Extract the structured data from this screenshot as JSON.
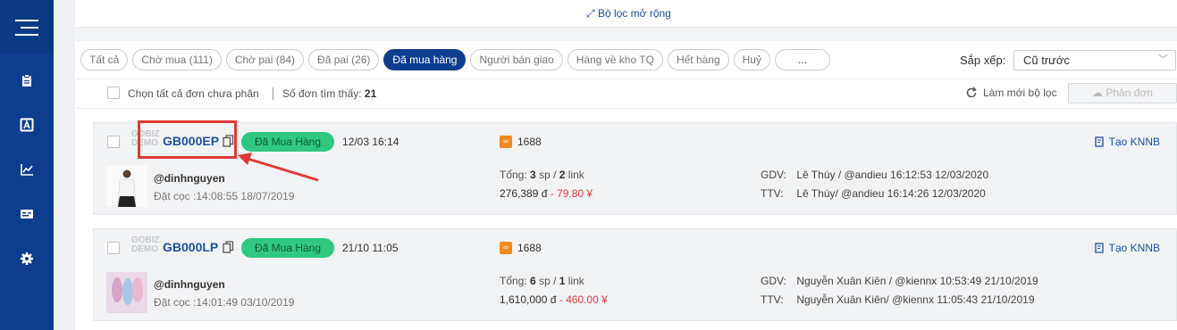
{
  "sidebar": {
    "items": [
      {
        "icon": "clipboard-icon"
      },
      {
        "icon": "font-icon"
      },
      {
        "icon": "chart-icon"
      },
      {
        "icon": "card-icon"
      },
      {
        "icon": "gear-icon"
      }
    ]
  },
  "header": {
    "filter_link": "Bộ lọc mở rộng"
  },
  "tabs": [
    {
      "label": "Tất cả",
      "active": false
    },
    {
      "label": "Chờ mua (111)",
      "active": false
    },
    {
      "label": "Chờ pai (84)",
      "active": false
    },
    {
      "label": "Đã pai (26)",
      "active": false
    },
    {
      "label": "Đã mua hàng",
      "active": true
    },
    {
      "label": "Người bán giao",
      "active": false
    },
    {
      "label": "Hàng về kho TQ",
      "active": false
    },
    {
      "label": "Hết hàng",
      "active": false
    },
    {
      "label": "Huỷ",
      "active": false
    },
    {
      "label": "...",
      "active": false
    }
  ],
  "sort": {
    "label": "Sắp xếp:",
    "value": "Cũ trước"
  },
  "toolbar": {
    "select_all": "Chọn tất cả đơn chưa phân",
    "found_label": "Số đơn tìm thấy:",
    "found_count": "21",
    "refresh": "Làm mới bộ lọc",
    "split": "Phân đơn"
  },
  "orders": [
    {
      "logo_text": "GOBIZ DEMO",
      "code": "GB000EP",
      "status": "Đã Mua Hàng",
      "datetime": "12/03 16:14",
      "source": "1688",
      "action": "Tạo KNNB",
      "buyer": "@dinhnguyen",
      "deposit": "Đặt cọc :14:08:55 18/07/2019",
      "tong_prefix": "Tổng:",
      "sp": "3",
      "sp_unit": "sp /",
      "link": "2",
      "link_unit": "link",
      "vnd": "276,389 đ",
      "cny": "- 79.80 ¥",
      "gdv_label": "GDV:",
      "gdv": "Lê Thúy / @andieu 16:12:53 12/03/2020",
      "ttv_label": "TTV:",
      "ttv": "Lê Thúy/ @andieu 16:14:26 12/03/2020"
    },
    {
      "logo_text": "GOBIZ DEMO",
      "code": "GB000LP",
      "status": "Đã Mua Hàng",
      "datetime": "21/10 11:05",
      "source": "1688",
      "action": "Tạo KNNB",
      "buyer": "@dinhnguyen",
      "deposit": "Đặt cọc :14:01:49 03/10/2019",
      "tong_prefix": "Tổng:",
      "sp": "6",
      "sp_unit": "sp /",
      "link": "1",
      "link_unit": "link",
      "vnd": "1,610,000 đ",
      "cny": "- 460.00 ¥",
      "gdv_label": "GDV:",
      "gdv": "Nguyễn Xuân Kiên / @kiennx 10:53:49 21/10/2019",
      "ttv_label": "TTV:",
      "ttv": "Nguyễn Xuân Kiên/ @kiennx 11:05:43 21/10/2019"
    }
  ],
  "colors": {
    "sidebar": "#0d3e8e",
    "accent": "#1e4fa3",
    "status_green": "#2fc882",
    "price_red": "#e23b3b",
    "highlight": "#e03a3a"
  }
}
